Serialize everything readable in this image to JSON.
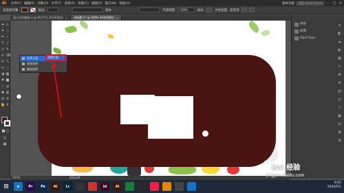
{
  "menubar": {
    "logo": "Ai",
    "items": [
      "文件(F)",
      "编辑(E)",
      "对象(O)",
      "文字(T)",
      "选择(S)",
      "效果(C)",
      "视图(V)",
      "窗口(W)",
      "帮助(H)"
    ],
    "workspace": "基本功能",
    "search_placeholder": "搜索 Adobe Stock"
  },
  "controlbar": {
    "label": "未选择对象",
    "stroke_label": "描边:",
    "style_label": "基本",
    "opacity_label": "不透明度:",
    "opacity_value": "100%",
    "style2_label": "样式:",
    "doc_setup": "文档设置",
    "prefs": "首选项"
  },
  "tabs": [
    {
      "label": "展示应用编辑.ai @ 66.67% (RGB/预览)",
      "active": false
    },
    {
      "label": "未标题-1* @ 200% (RGB/预览)",
      "active": true
    }
  ],
  "popup": {
    "items": [
      "选择工具",
      "直接选择",
      "编组选择"
    ],
    "submenu": [
      "魔棒工具",
      "套索工具",
      "画板"
    ],
    "highlight": "选择工具"
  },
  "rightpanel": {
    "tabs": [
      "字符",
      "段落",
      "OpenType"
    ]
  },
  "statusbar": {
    "zoom": "200%",
    "tool": "直接选择"
  },
  "taskbar": {
    "apps": [
      {
        "label": "e",
        "color": "#1a6fc4"
      },
      {
        "label": "Pr",
        "color": "#2a0a48"
      },
      {
        "label": "Ps",
        "color": "#0a2a48"
      },
      {
        "label": "Ai",
        "color": "#3a1a00"
      },
      {
        "label": "Lr",
        "color": "#0a2436"
      },
      {
        "label": "",
        "color": "#333"
      },
      {
        "label": "",
        "color": "#c33"
      },
      {
        "label": "Id",
        "color": "#3a0a20"
      },
      {
        "label": "Ai",
        "color": "#3a1a00"
      },
      {
        "label": "",
        "color": "#1b7d3a"
      },
      {
        "label": "",
        "color": "#2a2a2a"
      },
      {
        "label": "",
        "color": "#e24"
      },
      {
        "label": "",
        "color": "#d80"
      },
      {
        "label": "",
        "color": "#444"
      },
      {
        "label": "",
        "color": "#1a6fc4"
      }
    ],
    "time": "9:05",
    "date": "2020/5/1"
  },
  "watermark": {
    "name": "Bai 经验",
    "url": "jingyan.baidu.com"
  },
  "colors": {
    "shape": "#4a1410",
    "highlight": "#e11111"
  }
}
